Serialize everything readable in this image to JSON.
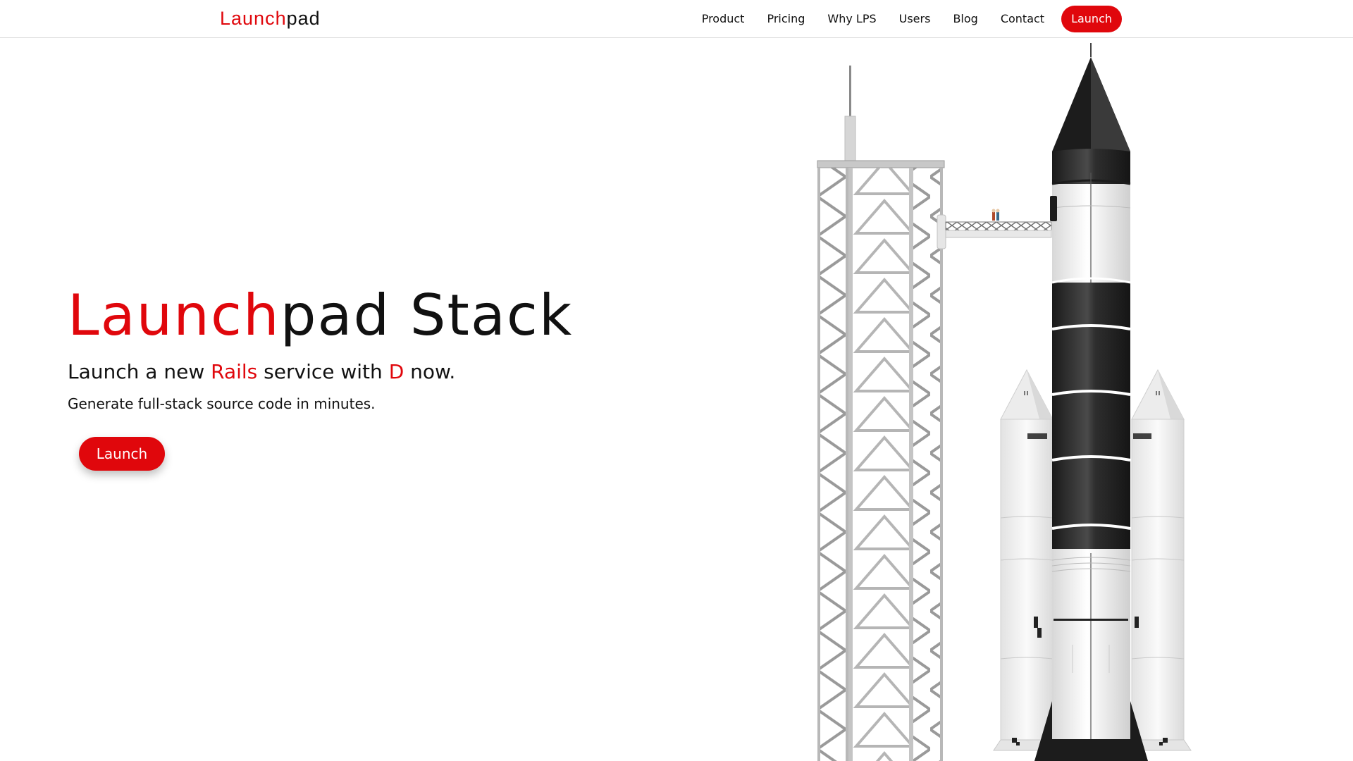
{
  "nav": {
    "logo": {
      "part1": "Launch",
      "part2": "pad"
    },
    "links": [
      "Product",
      "Pricing",
      "Why LPS",
      "Users",
      "Blog",
      "Contact"
    ],
    "launch_label": "Launch"
  },
  "hero": {
    "title": {
      "part1": "Launch",
      "part2": "pad",
      "part3": " Stack"
    },
    "subtitle": {
      "pre": "Launch a new ",
      "tech1": "Rails",
      "mid": " service with ",
      "tech2": "D",
      "post": " now."
    },
    "description": "Generate full-stack source code in minutes.",
    "button_label": "Launch"
  },
  "colors": {
    "accent": "#e0070c",
    "text": "#111111",
    "background": "#ffffff"
  }
}
